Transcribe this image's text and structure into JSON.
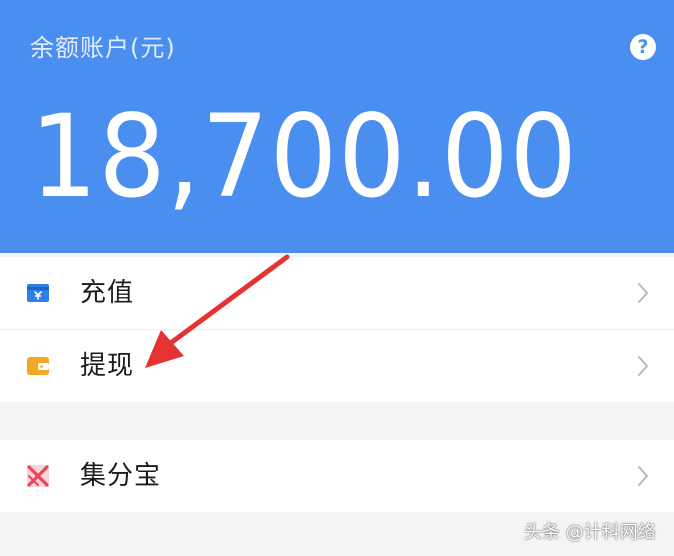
{
  "account": {
    "title": "余额账户(元)",
    "help_icon": "question-icon",
    "help_glyph": "?",
    "balance": "18,700.00"
  },
  "menu": {
    "items": [
      {
        "label": "充值",
        "icon": "recharge-card-icon",
        "icon_color": "#2e7fe8"
      },
      {
        "label": "提现",
        "icon": "wallet-icon",
        "icon_color": "#f5a623"
      },
      {
        "label": "集分宝",
        "icon": "jifenbao-icon",
        "icon_color": "#e8455a"
      }
    ]
  },
  "annotation": {
    "arrow_color": "#e53333"
  },
  "watermark": "头条 @计科网络",
  "colors": {
    "header_bg": "#4a8ef0",
    "page_bg": "#f3f4f6"
  }
}
